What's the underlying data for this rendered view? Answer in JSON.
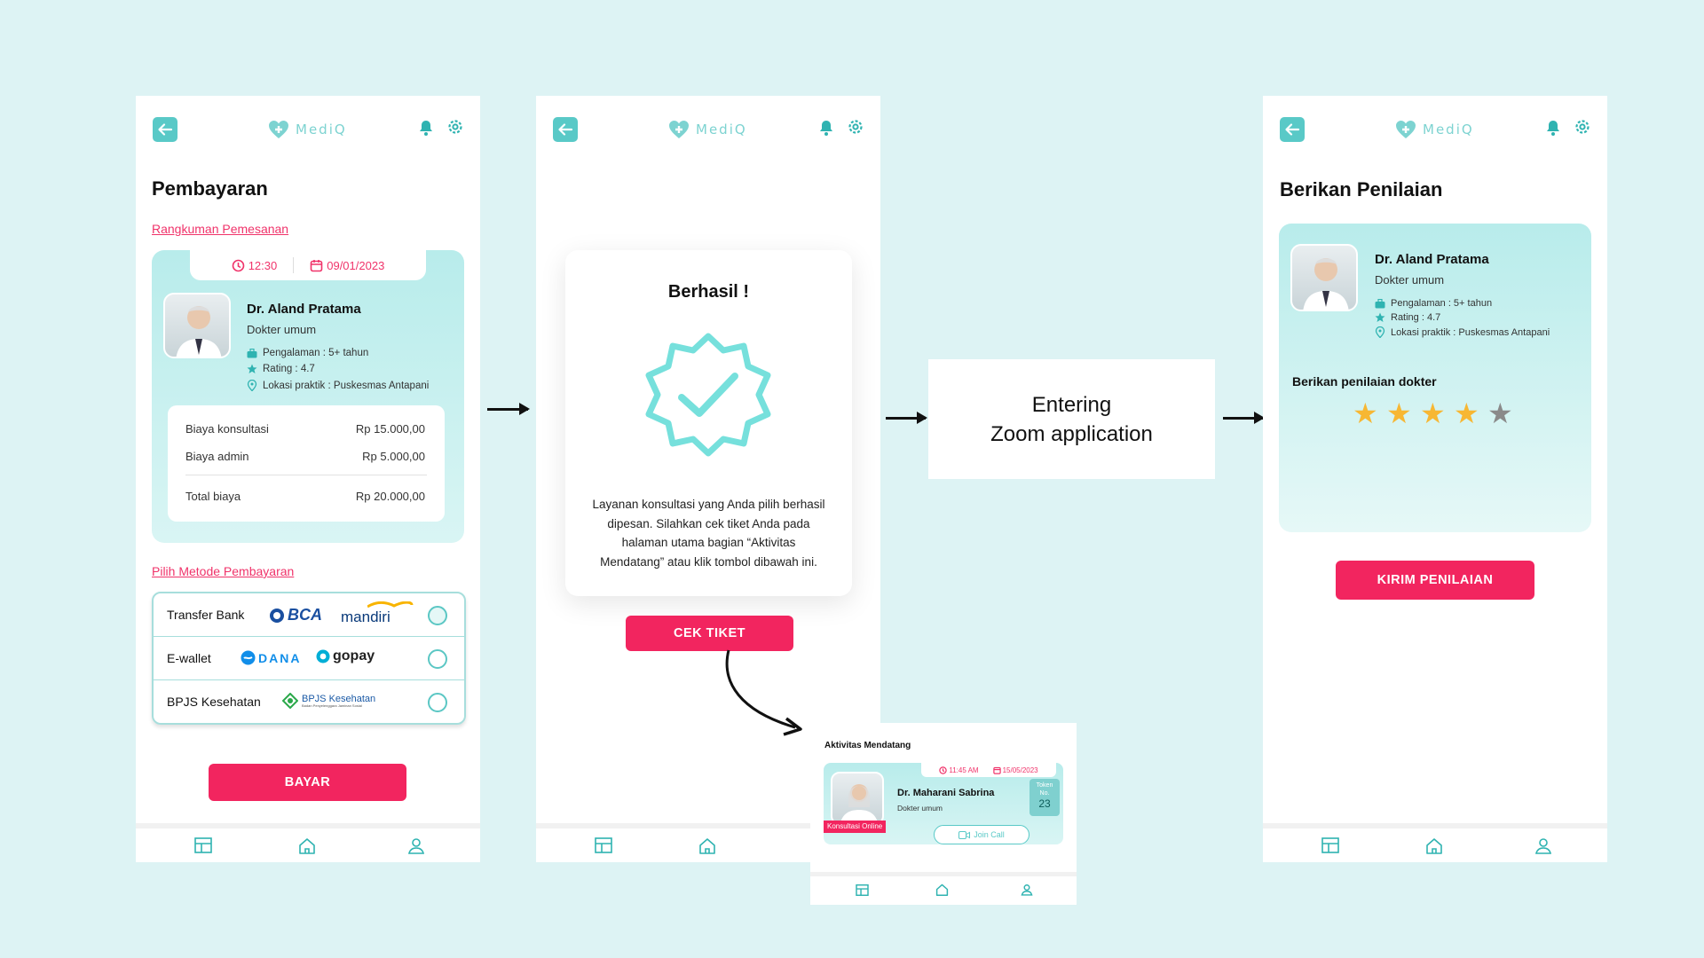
{
  "app": {
    "logo": "MediQ"
  },
  "payment": {
    "title": "Pembayaran",
    "summary_link": "Rangkuman Pemesanan",
    "time": "12:30",
    "date": "09/01/2023",
    "doctor": {
      "name": "Dr. Aland Pratama",
      "specialty": "Dokter umum",
      "experience": "Pengalaman : 5+ tahun",
      "rating": "Rating : 4.7",
      "location": "Lokasi praktik : Puskesmas Antapani"
    },
    "costs": [
      {
        "label": "Biaya konsultasi",
        "value": "Rp 15.000,00"
      },
      {
        "label": "Biaya admin",
        "value": "Rp 5.000,00"
      }
    ],
    "total": {
      "label": "Total biaya",
      "value": "Rp 20.000,00"
    },
    "method_link": "Pilih Metode Pembayaran",
    "methods": [
      {
        "label": "Transfer Bank",
        "logos": [
          "BCA",
          "mandiri"
        ]
      },
      {
        "label": "E-wallet",
        "logos": [
          "DANA",
          "gopay"
        ]
      },
      {
        "label": "BPJS Kesehatan",
        "logos": [
          "BPJS Kesehatan",
          "Badan Penyelenggara Jaminan Sosial"
        ]
      }
    ],
    "pay_button": "BAYAR"
  },
  "success": {
    "title": "Berhasil !",
    "message": "Layanan konsultasi yang Anda pilih berhasil dipesan. Silahkan cek tiket Anda pada halaman utama bagian “Aktivitas Mendatang” atau klik tombol dibawah ini.",
    "button": "CEK TIKET"
  },
  "upcoming": {
    "title": "Aktivitas Mendatang",
    "time": "11:45 AM",
    "date": "15/05/2023",
    "doctor_name": "Dr. Maharani Sabrina",
    "specialty": "Dokter umum",
    "token_label": "Token No.",
    "token_number": "23",
    "badge": "Konsultasi Online",
    "join_button": "Join Call"
  },
  "zoom_box": {
    "line1": "Entering",
    "line2": "Zoom application"
  },
  "rating": {
    "title": "Berikan Penilaian",
    "doctor": {
      "name": "Dr. Aland Pratama",
      "specialty": "Dokter umum",
      "experience": "Pengalaman : 5+ tahun",
      "rating": "Rating : 4.7",
      "location": "Lokasi praktik : Puskesmas Antapani"
    },
    "prompt": "Berikan penilaian dokter",
    "stars_filled": 4,
    "stars_total": 5,
    "submit_button": "KIRIM PENILAIAN"
  },
  "colors": {
    "teal": "#59c9c7",
    "pink": "#f2255f",
    "star": "#f7b733",
    "star_empty": "#8a8a8a"
  },
  "icons": [
    "back-arrow-icon",
    "bell-icon",
    "gear-icon",
    "clock-icon",
    "calendar-icon",
    "briefcase-icon",
    "star-icon",
    "location-icon",
    "dashboard-icon",
    "home-icon",
    "profile-icon",
    "verified-badge-icon",
    "video-icon"
  ]
}
